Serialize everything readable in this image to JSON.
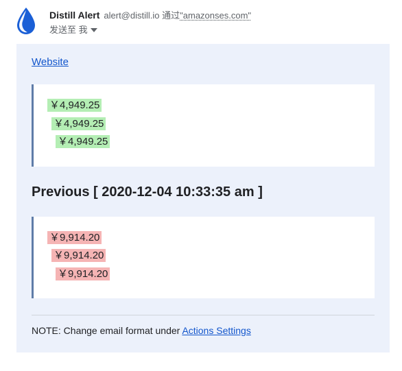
{
  "header": {
    "sender_name": "Distill Alert",
    "sender_email": "alert@distill.io",
    "via_label": "通过",
    "via_domain": "\"amazonses.com\"",
    "recipient_line": "发送至 我"
  },
  "body": {
    "website_link_label": "Website",
    "current": {
      "prices": [
        "￥4,949.25",
        "￥4,949.25",
        "￥4,949.25"
      ]
    },
    "previous_heading": "Previous [ 2020-12-04 10:33:35 am ]",
    "previous": {
      "prices": [
        "￥9,914.20",
        "￥9,914.20",
        "￥9,914.20"
      ]
    },
    "note_prefix": "NOTE: Change email format under ",
    "note_link_label": "Actions Settings"
  },
  "icons": {
    "avatar": "distill-drop-icon",
    "caret": "chevron-down-icon"
  }
}
